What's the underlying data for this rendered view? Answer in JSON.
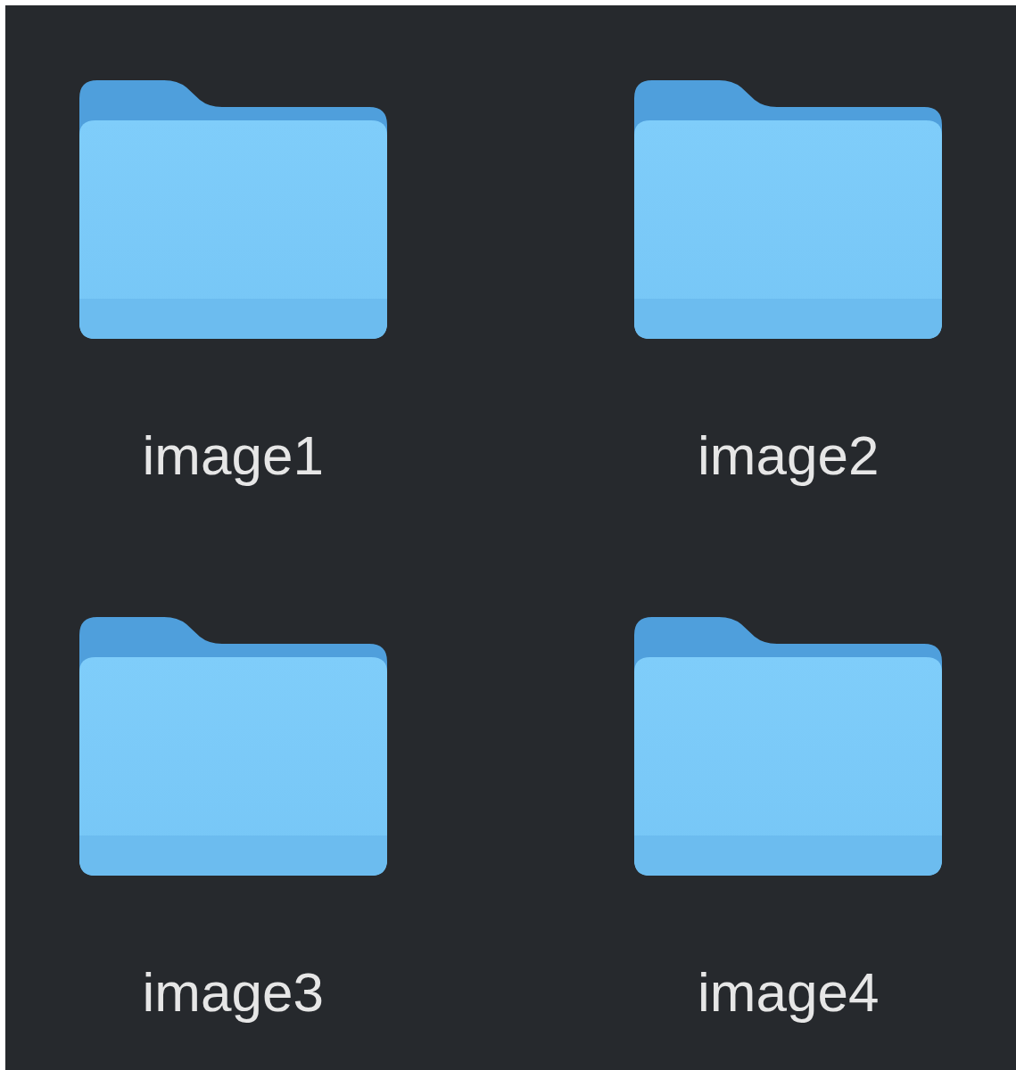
{
  "folders": [
    {
      "name": "image1"
    },
    {
      "name": "image2"
    },
    {
      "name": "image3"
    },
    {
      "name": "image4"
    }
  ]
}
